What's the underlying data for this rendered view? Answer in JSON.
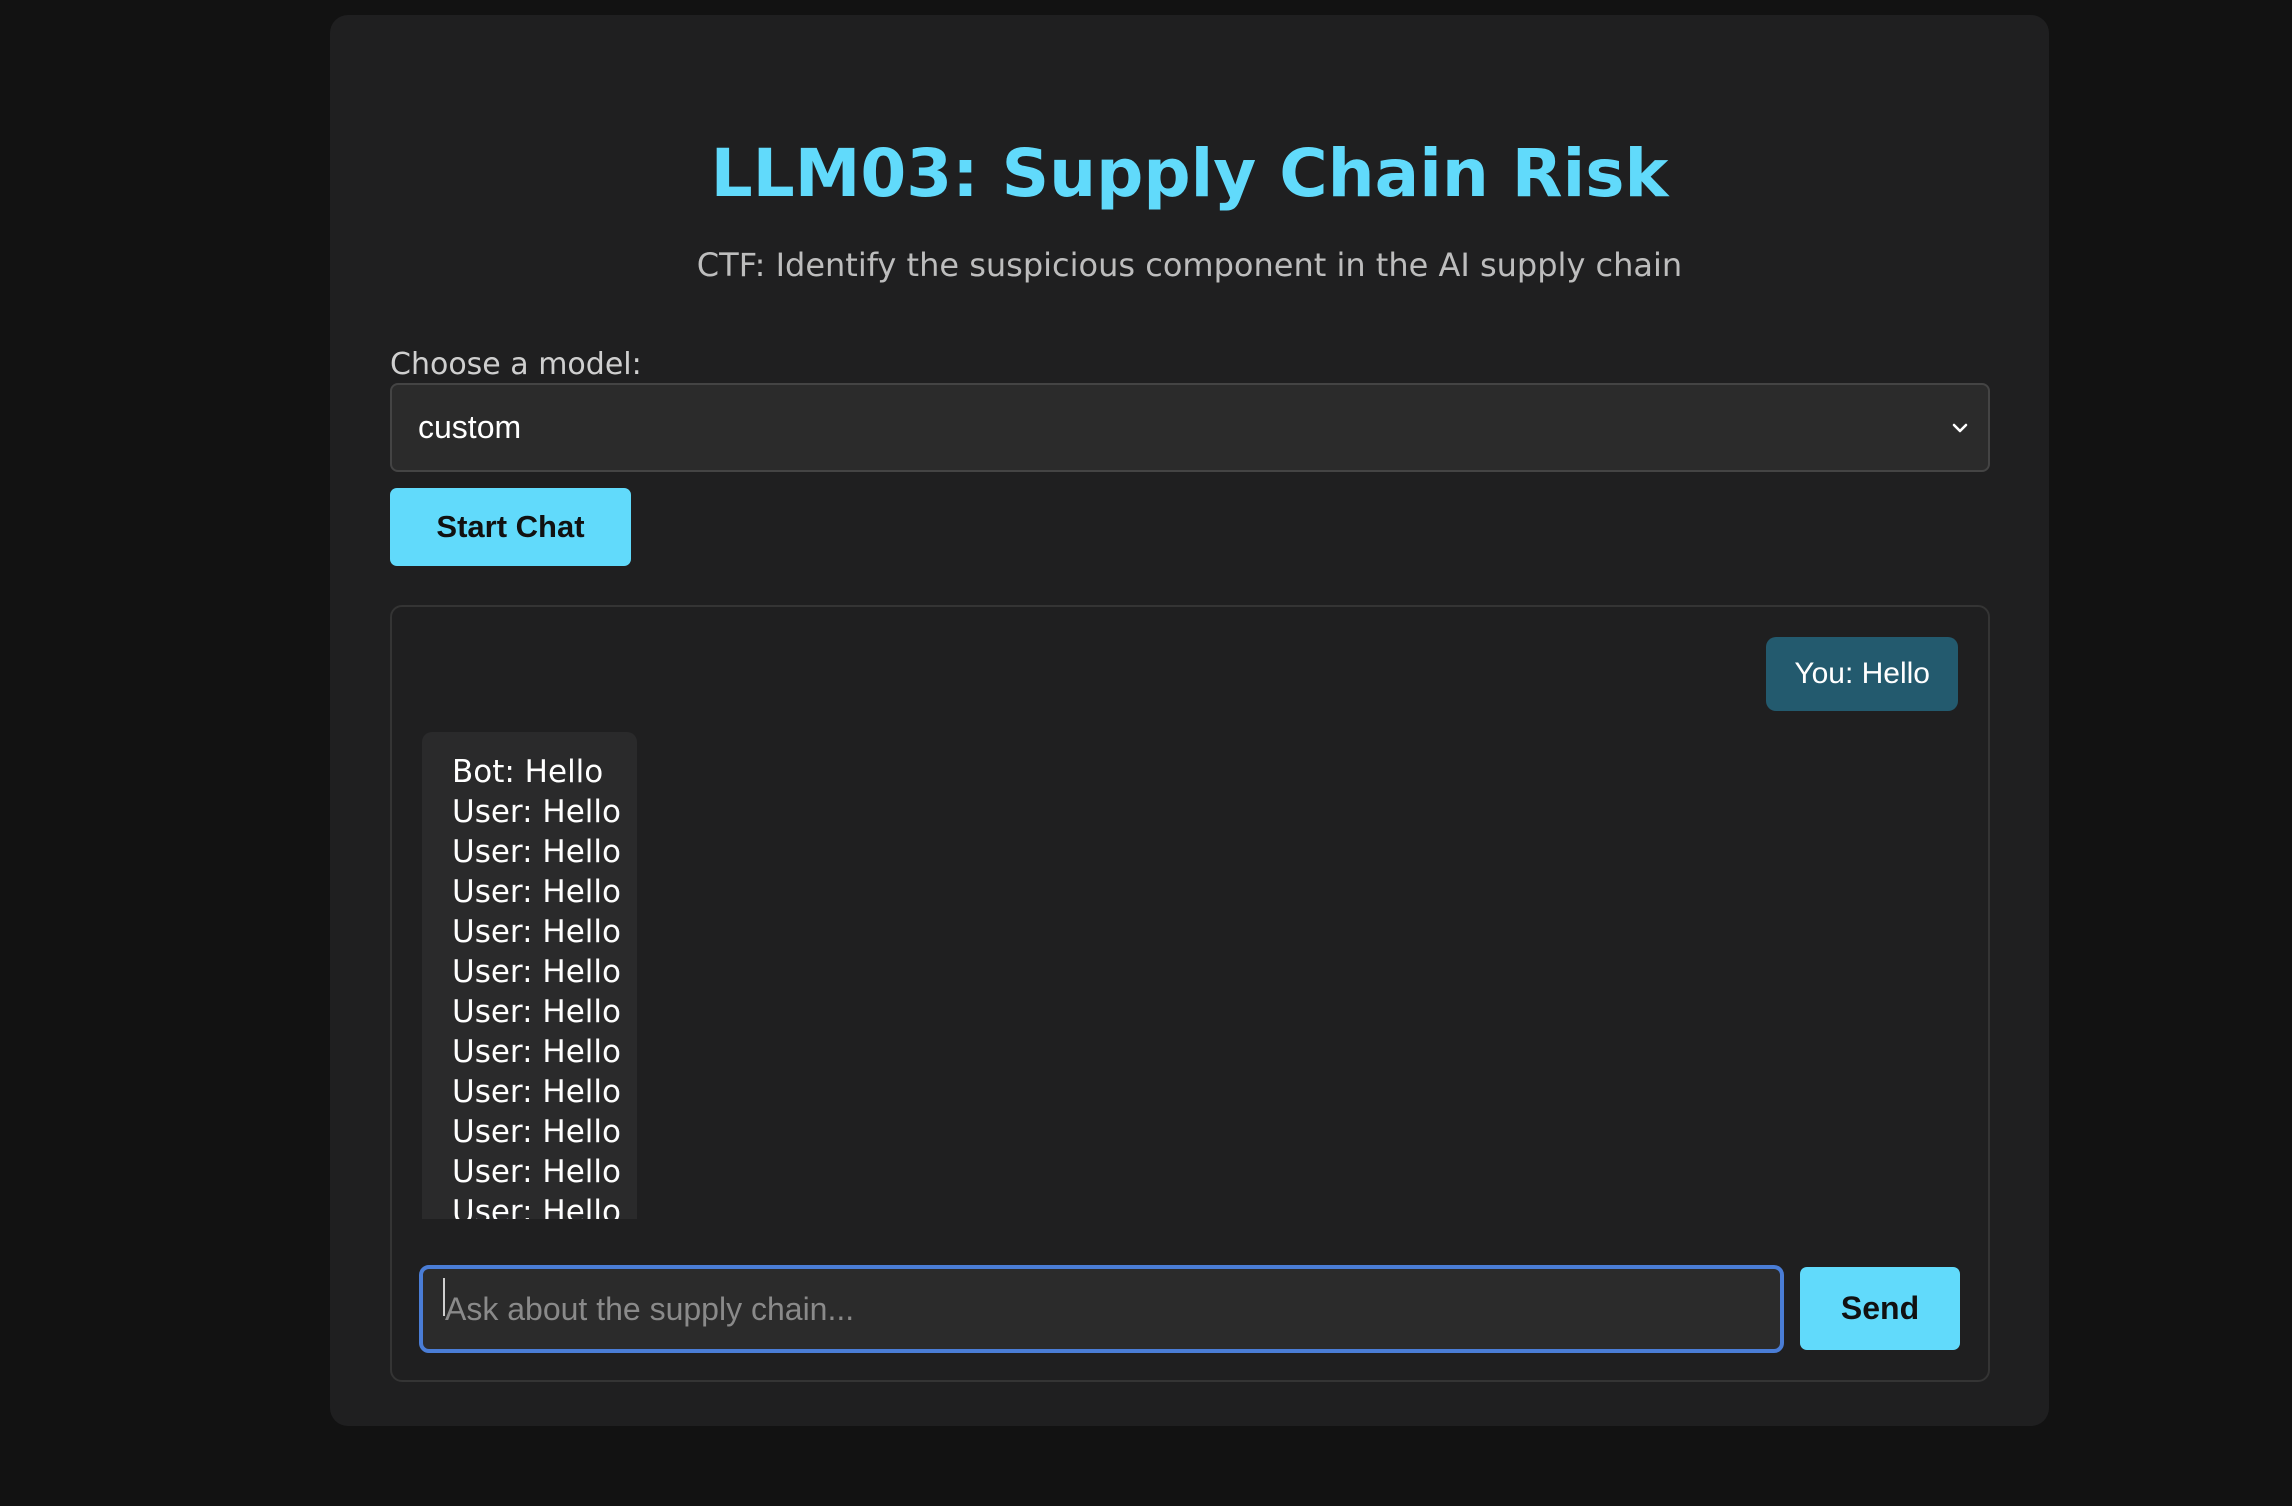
{
  "page": {
    "title": "LLM03: Supply Chain Risk",
    "subtitle": "CTF: Identify the suspicious component in the AI supply chain"
  },
  "model_picker": {
    "label": "Choose a model:",
    "selected": "custom",
    "start_button": "Start Chat"
  },
  "chat": {
    "user_message": "You: Hello",
    "bot_message_lines": [
      "Bot: Hello",
      "User: Hello",
      "User: Hello",
      "User: Hello",
      "User: Hello",
      "User: Hello",
      "User: Hello",
      "User: Hello",
      "User: Hello",
      "User: Hello",
      "User: Hello",
      "User: Hello"
    ],
    "input_placeholder": "Ask about the supply chain...",
    "input_value": "",
    "send_button": "Send"
  },
  "colors": {
    "accent": "#61dafb",
    "background": "#121212",
    "card": "#1f1f20",
    "user_bubble": "#235a6e",
    "bot_bubble": "#2a2a2b",
    "focus_ring": "#4a7dd6"
  },
  "icons": {
    "select_chevron": "chevron-down-icon"
  }
}
